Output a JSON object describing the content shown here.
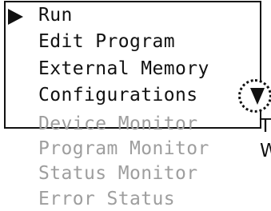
{
  "menu": {
    "visible_items": [
      {
        "label": "Run",
        "selected": true
      },
      {
        "label": "Edit Program",
        "selected": false
      },
      {
        "label": "External Memory",
        "selected": false
      },
      {
        "label": "Configurations",
        "selected": false
      }
    ],
    "hidden_items": [
      {
        "label": "Device Monitor"
      },
      {
        "label": "Program Monitor"
      },
      {
        "label": "Status Monitor"
      },
      {
        "label": "Error Status"
      }
    ],
    "pointer_icon": "triangle-right-icon",
    "scroll_icon": "scroll-down-arrow-icon"
  },
  "side_text": {
    "line1": "T",
    "line2": "W"
  },
  "colors": {
    "foreground": "#111111",
    "dimmed": "#9e9e9e",
    "background": "#ffffff"
  }
}
